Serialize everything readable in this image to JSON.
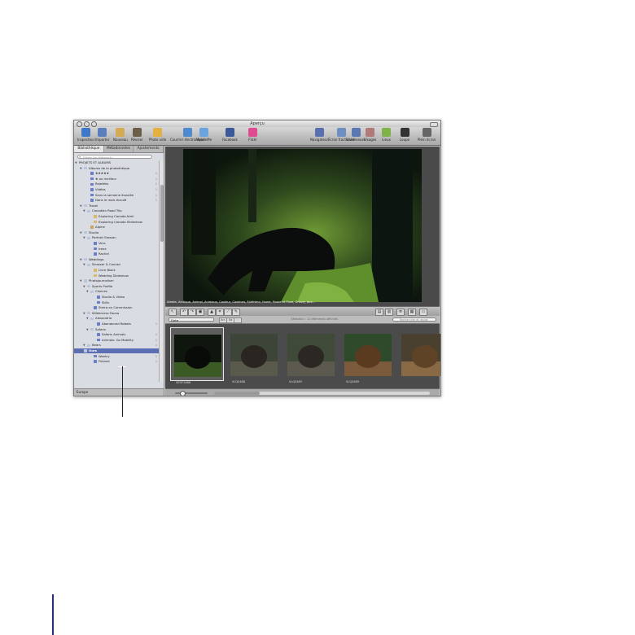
{
  "window": {
    "title": "Aperçu"
  },
  "toolbar": {
    "left": [
      {
        "label": "Inspecteur",
        "icon": "info-icon",
        "color": "#3f78c9"
      },
      {
        "label": "Importer",
        "icon": "import-icon",
        "color": "#5b7fbd"
      },
      {
        "label": "Nouveau",
        "icon": "new-folder-icon",
        "color": "#d4aa55"
      },
      {
        "label": "Réviser",
        "icon": "person-icon",
        "color": "#6b5e4a"
      },
      {
        "label": "Photo vide",
        "icon": "photo-icon",
        "color": "#e4b040"
      }
    ],
    "mid": [
      {
        "label": "Courrier électronique",
        "icon": "mail-icon",
        "color": "#4f89cf"
      },
      {
        "label": "MobileMe",
        "icon": "mobileme-icon",
        "color": "#6aa3dd"
      },
      {
        "label": "Facebook",
        "icon": "facebook-icon",
        "color": "#3b5998"
      },
      {
        "label": "Flickr",
        "icon": "flickr-icon",
        "color": "#e04b8f"
      }
    ],
    "right": [
      {
        "label": "Navigateur",
        "icon": "grid-icon",
        "color": "#5a6fb0"
      },
      {
        "label": "Écran fractionné",
        "icon": "split-view-icon",
        "color": "#6d8fc4"
      },
      {
        "label": "Visionneuse",
        "icon": "viewer-icon",
        "color": "#5b78b2"
      },
      {
        "label": "Visages",
        "icon": "faces-icon",
        "color": "#b07a7a"
      },
      {
        "label": "Lieux",
        "icon": "places-icon",
        "color": "#7fb34a"
      },
      {
        "label": "Loupe",
        "icon": "loupe-icon",
        "color": "#333333"
      },
      {
        "label": "Plein écran",
        "icon": "fullscreen-icon",
        "color": "#666666"
      }
    ]
  },
  "sidebar": {
    "tabs": [
      "Bibliothèque",
      "Métadonnées",
      "Ajustements"
    ],
    "filter_placeholder": "Filtrer les éléments",
    "items": [
      {
        "label": "PROJETS ET ALBUMS",
        "indent": 2,
        "kind": "header"
      },
      {
        "label": "Albums de la photothèque",
        "indent": 8,
        "kind": "folder"
      },
      {
        "label": "★★★★★",
        "indent": 16,
        "kind": "album",
        "count": "1"
      },
      {
        "label": "★ ou meilleur",
        "indent": 16,
        "kind": "album",
        "count": "1"
      },
      {
        "label": "Rejetées",
        "indent": 16,
        "kind": "album",
        "count": "1"
      },
      {
        "label": "Vidéos",
        "indent": 16,
        "kind": "album",
        "count": "1"
      },
      {
        "label": "Sans la semaine écoulée",
        "indent": 16,
        "kind": "album",
        "count": "1"
      },
      {
        "label": "Dans le mois écoulé",
        "indent": 16,
        "kind": "album",
        "count": "1"
      },
      {
        "label": "Travel",
        "indent": 8,
        "kind": "folder"
      },
      {
        "label": "Canadian Road Trip",
        "indent": 12,
        "kind": "folder"
      },
      {
        "label": "Exploring Canada.html",
        "indent": 20,
        "kind": "file"
      },
      {
        "label": "Exploring Canada Slideshow",
        "indent": 20,
        "kind": "file"
      },
      {
        "label": "Alpine",
        "indent": 16,
        "kind": "project"
      },
      {
        "label": "Studio",
        "indent": 8,
        "kind": "folder"
      },
      {
        "label": "Portrait Session",
        "indent": 12,
        "kind": "folder"
      },
      {
        "label": "Vera",
        "indent": 20,
        "kind": "album"
      },
      {
        "label": "Irene",
        "indent": 20,
        "kind": "album"
      },
      {
        "label": "Rachel",
        "indent": 20,
        "kind": "album"
      },
      {
        "label": "Weddings",
        "indent": 8,
        "kind": "folder"
      },
      {
        "label": "Strasser & Conrad",
        "indent": 12,
        "kind": "folder"
      },
      {
        "label": "Livre Black",
        "indent": 20,
        "kind": "file"
      },
      {
        "label": "Wedding Slideshow",
        "indent": 20,
        "kind": "file"
      },
      {
        "label": "Photojournalism",
        "indent": 8,
        "kind": "folder"
      },
      {
        "label": "Sports Profile",
        "indent": 12,
        "kind": "folder"
      },
      {
        "label": "Choices",
        "indent": 16,
        "kind": "folder"
      },
      {
        "label": "Studio & Video",
        "indent": 24,
        "kind": "album"
      },
      {
        "label": "Stills",
        "indent": 24,
        "kind": "album"
      },
      {
        "label": "Sierra on Commission",
        "indent": 20,
        "kind": "album"
      },
      {
        "label": "Wilderness Fauna",
        "indent": 12,
        "kind": "folder"
      },
      {
        "label": "Alexandria",
        "indent": 16,
        "kind": "folder"
      },
      {
        "label": "Abandoned Robots",
        "indent": 24,
        "kind": "album",
        "count": "1"
      },
      {
        "label": "Safaris",
        "indent": 16,
        "kind": "folder"
      },
      {
        "label": "Safaris Animals",
        "indent": 24,
        "kind": "album",
        "count": "1"
      },
      {
        "label": "Animals: Go Mobility",
        "indent": 24,
        "kind": "album",
        "count": "1"
      },
      {
        "label": "Bears",
        "indent": 12,
        "kind": "folder",
        "count": "1"
      },
      {
        "label": "Ours",
        "indent": 8,
        "kind": "folder",
        "selected": true
      },
      {
        "label": "Weekly",
        "indent": 20,
        "kind": "album",
        "count": "1"
      },
      {
        "label": "Finland",
        "indent": 20,
        "kind": "album",
        "count": "1"
      }
    ],
    "footer": "Europe"
  },
  "viewer": {
    "caption": "Alaska, Arctique, Animal, Animaux, Couleur, Couleurs, Extérieur, faune, Faune et Flore, Grizzly, Jour…"
  },
  "browser": {
    "sort": "Date",
    "view_buttons": [
      "Arr.",
      "Gd",
      "⋯"
    ],
    "status": "Sélection : 12 éléments affichés",
    "search_placeholder": "Rechercher et rouge",
    "thumbnails": [
      {
        "label": "VEGF1668",
        "selected": true
      },
      {
        "label": "VLQ0488",
        "selected": false
      },
      {
        "label": "VLQ0483",
        "selected": false
      },
      {
        "label": "VLQ0489",
        "selected": false
      },
      {
        "label": "",
        "selected": false
      }
    ]
  },
  "colors": {
    "selection": "#5d6fb4",
    "background": "#4a4a4a"
  }
}
